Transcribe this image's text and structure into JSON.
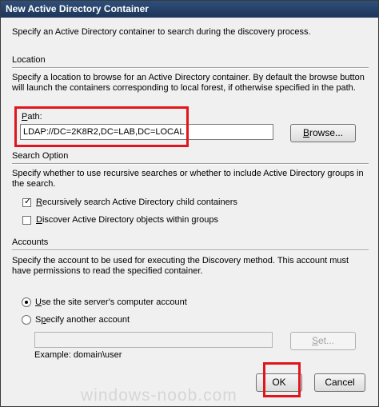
{
  "window": {
    "title": "New Active Directory Container"
  },
  "intro": {
    "text": "Specify an Active Directory container to search during the discovery process."
  },
  "location": {
    "header": "Location",
    "desc1": "Specify a location to browse for an Active Directory container. By default the browse button",
    "desc2": "will launch the containers corresponding to local forest, if otherwise specified in the path.",
    "path_label_first": "P",
    "path_label_rest": "ath:",
    "path_value": "LDAP://DC=2K8R2,DC=LAB,DC=LOCAL",
    "browse_first": "B",
    "browse_rest": "rowse..."
  },
  "search": {
    "header": "Search Option",
    "desc1": "Specify whether to use recursive searches or whether to include Active Directory groups in",
    "desc2": "the search.",
    "recursive_first": "R",
    "recursive_rest": "ecursively search Active Directory child containers",
    "recursive_checked": true,
    "discover_first": "D",
    "discover_rest": "iscover Active Directory objects within groups",
    "discover_checked": false
  },
  "accounts": {
    "header": "Accounts",
    "desc1": "Specify the account to be used for executing the Discovery method. This account must",
    "desc2": "have permissions to read the specified container.",
    "site_first": "U",
    "site_rest": "se the site server's computer account",
    "site_selected": true,
    "another_pre": "S",
    "another_first": "p",
    "another_rest": "ecify another account",
    "another_selected": false,
    "account_value": "",
    "set_first": "S",
    "set_rest": "et...",
    "example": "Example: domain\\user"
  },
  "footer": {
    "ok_label": "OK",
    "cancel_label": "Cancel"
  },
  "watermark": "windows-noob.com",
  "colors": {
    "highlight": "#e0161e",
    "titlebar": "#2f4f7a"
  }
}
